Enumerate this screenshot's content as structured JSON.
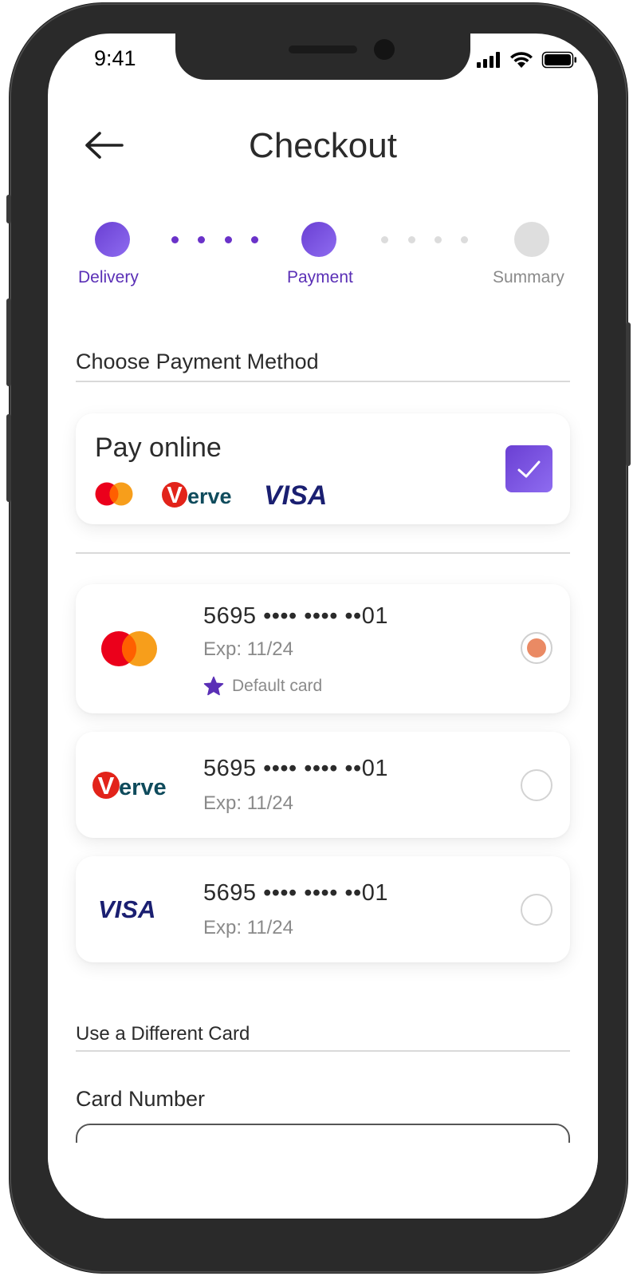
{
  "status_bar": {
    "time": "9:41"
  },
  "header": {
    "title": "Checkout"
  },
  "stepper": {
    "steps": [
      {
        "label": "Delivery",
        "state": "completed"
      },
      {
        "label": "Payment",
        "state": "current"
      },
      {
        "label": "Summary",
        "state": "pending"
      }
    ]
  },
  "payment_method": {
    "section_title": "Choose Payment Method",
    "pay_online": {
      "title": "Pay online",
      "checked": true,
      "brand_icons": [
        "mastercard-icon",
        "verve-icon",
        "visa-icon"
      ]
    }
  },
  "saved_cards": [
    {
      "brand": "mastercard",
      "number": "5695 •••• •••• ••01",
      "expiry": "Exp: 11/24",
      "default_label": "Default card",
      "selected": true
    },
    {
      "brand": "verve",
      "number": "5695 •••• •••• ••01",
      "expiry": "Exp: 11/24",
      "selected": false
    },
    {
      "brand": "visa",
      "number": "5695 •••• •••• ••01",
      "expiry": "Exp: 11/24",
      "selected": false
    }
  ],
  "different_card": {
    "section_title": "Use a Different Card",
    "card_number_label": "Card Number",
    "card_number_value": ""
  },
  "brand_text": {
    "verve_v": "V",
    "verve_rest": "erve",
    "visa": "VISA"
  },
  "colors": {
    "accent_purple": "#6a3fd3",
    "selected_radio": "#ea8a64",
    "mastercard_red": "#eb001b",
    "mastercard_orange": "#f79e1b",
    "verve_red": "#e2231a",
    "verve_teal": "#0f4b5c",
    "visa_blue": "#1a1f71"
  }
}
